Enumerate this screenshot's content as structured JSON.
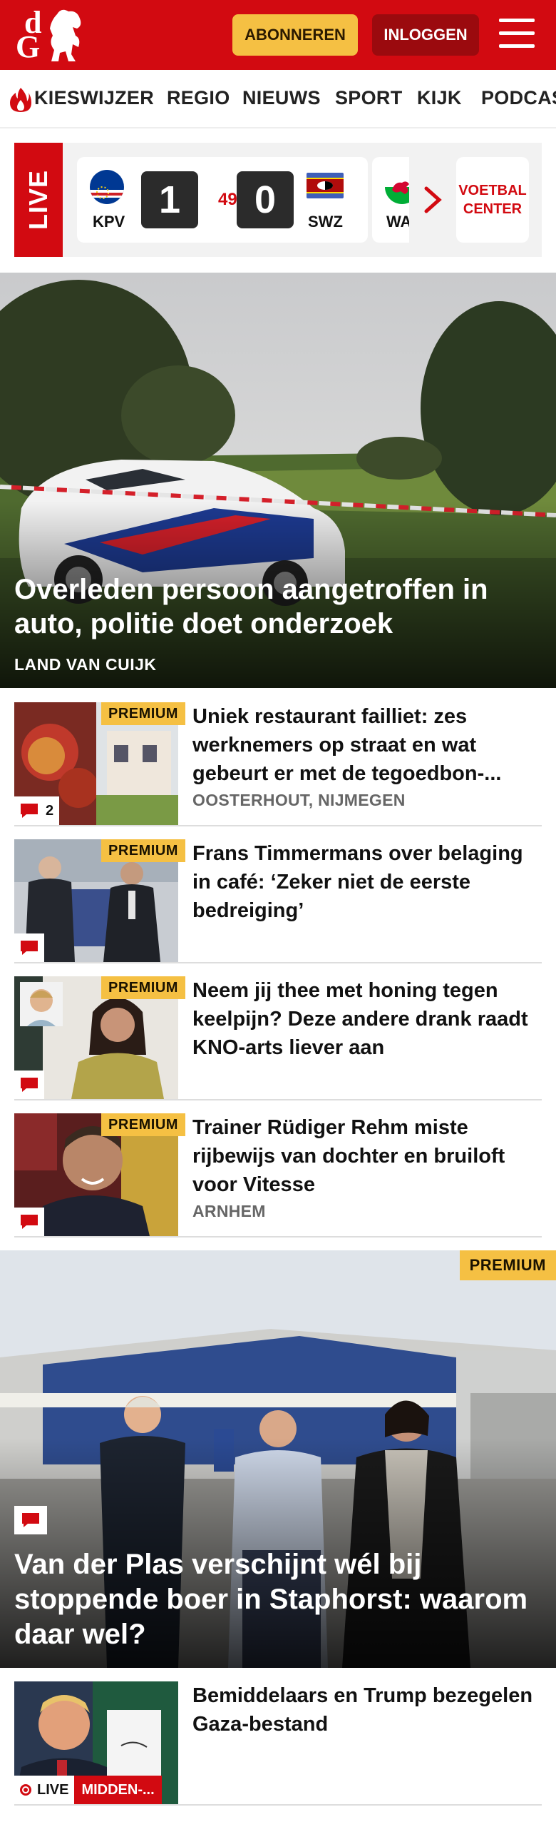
{
  "header": {
    "logo_d": "d",
    "logo_g": "G",
    "subscribe_label": "ABONNEREN",
    "login_label": "INLOGGEN",
    "brand_color": "#d20a11"
  },
  "nav": {
    "items": [
      "KIESWIJZER",
      "REGIO",
      "NIEUWS",
      "SPORT",
      "KIJK",
      "PODCAS"
    ]
  },
  "livebar": {
    "live_label": "LIVE",
    "match": {
      "home_code": "KPV",
      "home_score": "1",
      "minute": "49'",
      "away_score": "0",
      "away_code": "SWZ"
    },
    "next_match_code": "WA",
    "center_label_1": "VOETBAL",
    "center_label_2": "CENTER"
  },
  "hero": {
    "title": "Overleden persoon aangetroffen in auto, politie doet onderzoek",
    "location": "LAND VAN CUIJK"
  },
  "articles": [
    {
      "badge": "PREMIUM",
      "title": "Uniek restaurant failliet: zes werknemers op straat en wat gebeurt er met de tegoedbon-...",
      "location": "OOSTERHOUT, NIJMEGEN",
      "comments": "2"
    },
    {
      "badge": "PREMIUM",
      "title": "Frans Timmermans over belaging in café: ‘Zeker niet de eerste bedreiging’"
    },
    {
      "badge": "PREMIUM",
      "title": "Neem jij thee met honing tegen keelpijn? Deze andere drank raadt KNO-arts liever aan"
    },
    {
      "badge": "PREMIUM",
      "title": "Trainer Rüdiger Rehm miste rijbewijs van dochter en bruiloft voor Vitesse",
      "location": "ARNHEM"
    }
  ],
  "big_article": {
    "badge": "PREMIUM",
    "title": "Van der Plas verschijnt wél bij stoppende boer in Staphorst: waarom daar wel?"
  },
  "last_article": {
    "title": "Bemiddelaars en Trump bezegelen Gaza-bestand",
    "live_label": "LIVE",
    "section_label": "MIDDEN-..."
  }
}
